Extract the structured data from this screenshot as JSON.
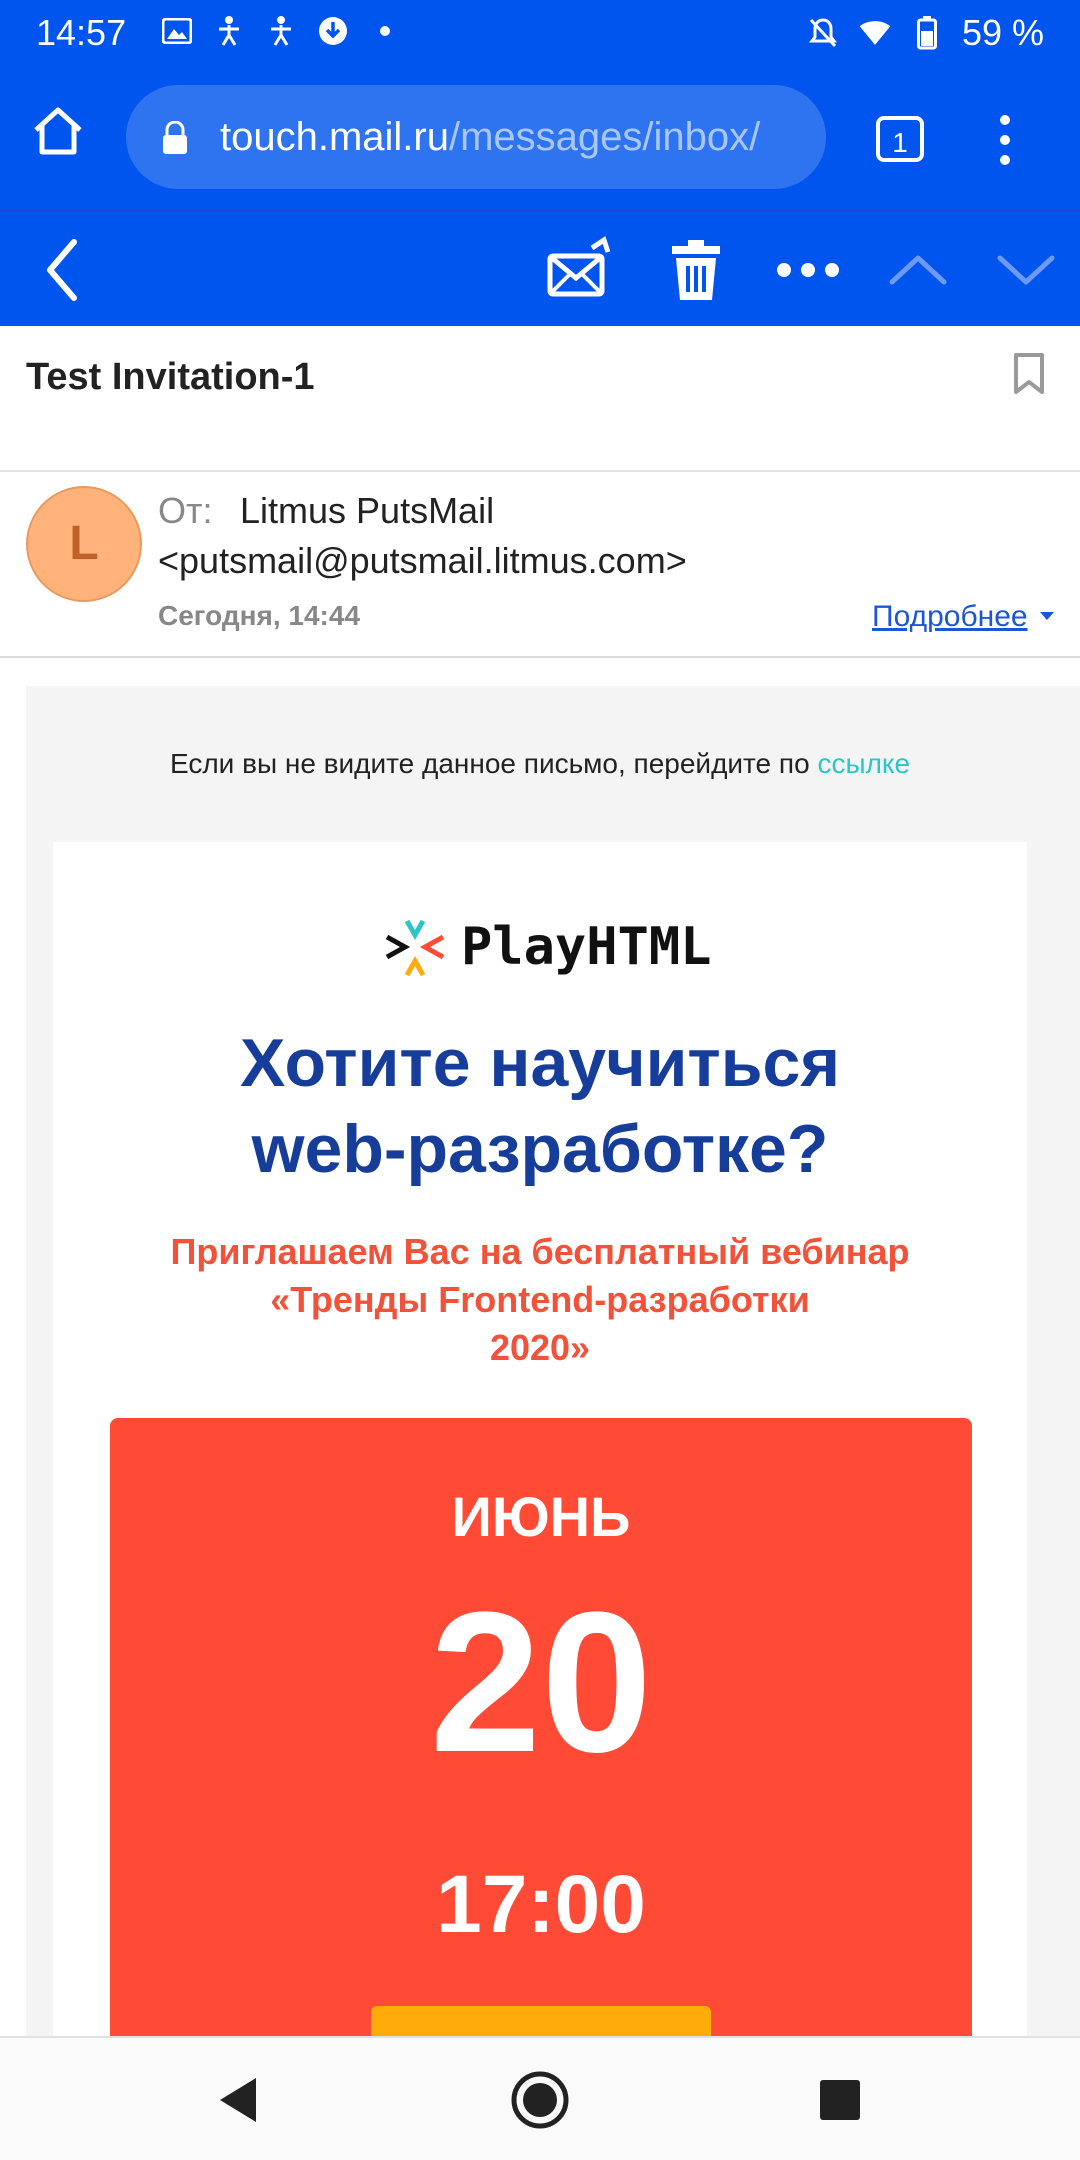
{
  "status_bar": {
    "time": "14:57",
    "battery": "59 %",
    "left_icons": [
      "image-icon",
      "accessibility-icon",
      "accessibility-icon",
      "download-icon",
      "dot-icon"
    ],
    "right_icons": [
      "bell-off-icon",
      "wifi-icon",
      "battery-icon"
    ]
  },
  "browser": {
    "url_domain": "touch.mail.ru",
    "url_path": "/messages/inbox/",
    "tab_count": "1"
  },
  "message": {
    "subject": "Test Invitation-1",
    "from_label": "От:",
    "sender_name": "Litmus PutsMail",
    "sender_email": "<putsmail@putsmail.litmus.com>",
    "avatar_letter": "L",
    "date": "Сегодня, 14:44",
    "details_label": "Подробнее"
  },
  "email": {
    "preheader_text": "Если вы не видите данное письмо, перейдите по ",
    "preheader_link": "ссылке",
    "logo_text": "PlayHTML",
    "headline_line1": "Хотите научиться",
    "headline_line2": "web-разработке?",
    "invite_line1": "Приглашаем Вас на бесплатный вебинар",
    "invite_line2": "«Тренды Frontend-разработки",
    "invite_line3": "2020»",
    "month": "ИЮНЬ",
    "day": "20",
    "time": "17:00"
  },
  "colors": {
    "brand_blue": "#0055ee",
    "headline_blue": "#173d9b",
    "accent_red": "#ff4a36",
    "link_teal": "#2cc6c9",
    "cta_orange": "#ffac0a"
  }
}
